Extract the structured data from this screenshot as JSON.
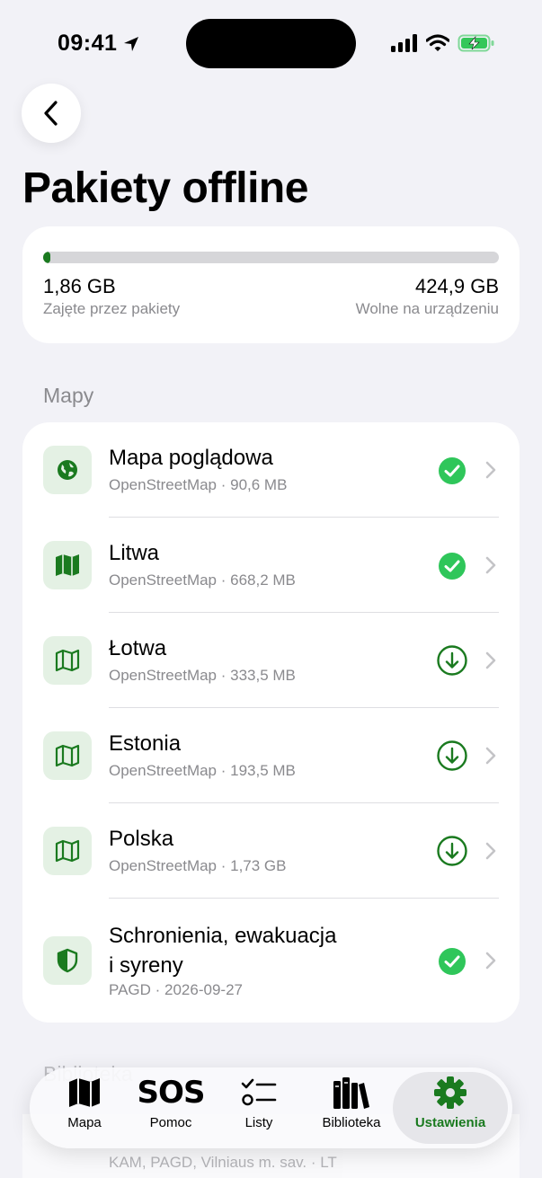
{
  "status_bar": {
    "time": "09:41"
  },
  "header": {
    "title": "Pakiety offline"
  },
  "storage": {
    "used_value": "1,86 GB",
    "used_label": "Zajęte przez pakiety",
    "free_value": "424,9 GB",
    "free_label": "Wolne na urządzeniu",
    "used_fraction": 0.0044,
    "bar_color": "#1a7a1f"
  },
  "sections": {
    "maps_title": "Mapy",
    "library_title": "Biblioteka"
  },
  "packages": [
    {
      "title": "Mapa poglądowa",
      "subtitle": "OpenStreetMap · 90,6 MB",
      "icon": "globe-icon",
      "status": "downloaded"
    },
    {
      "title": "Litwa",
      "subtitle": "OpenStreetMap · 668,2 MB",
      "icon": "map-filled-icon",
      "status": "downloaded"
    },
    {
      "title": "Łotwa",
      "subtitle": "OpenStreetMap · 333,5 MB",
      "icon": "map-outline-icon",
      "status": "download"
    },
    {
      "title": "Estonia",
      "subtitle": "OpenStreetMap · 193,5 MB",
      "icon": "map-outline-icon",
      "status": "download"
    },
    {
      "title": "Polska",
      "subtitle": "OpenStreetMap · 1,73 GB",
      "icon": "map-outline-icon",
      "status": "download"
    },
    {
      "title": "Schronienia, ewakuacja\ni syreny",
      "title_line1": "Schronienia, ewakuacja",
      "title_line2": "i syreny",
      "subtitle": "PAGD · 2026-09-27",
      "icon": "shield-icon",
      "status": "downloaded"
    }
  ],
  "peek_item": {
    "subtitle": "KAM, PAGD, Vilniaus m. sav. · LT"
  },
  "tabbar": {
    "tabs": [
      {
        "label": "Mapa",
        "icon": "map-icon"
      },
      {
        "label": "Pomoc",
        "icon": "sos-icon",
        "icon_text": "SOS"
      },
      {
        "label": "Listy",
        "icon": "checklist-icon"
      },
      {
        "label": "Biblioteka",
        "icon": "books-icon"
      },
      {
        "label": "Ustawienia",
        "icon": "gear-icon",
        "active": true
      }
    ]
  },
  "colors": {
    "accent": "#1a7a1f",
    "success": "#2fc65a",
    "background": "#f2f2f7"
  }
}
